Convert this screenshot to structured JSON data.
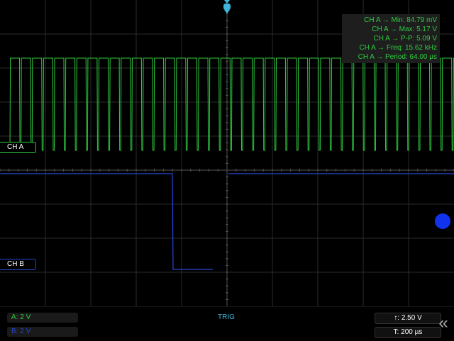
{
  "measurements": [
    "CH A → Min: 84.79 mV",
    "CH A → Max: 5.17 V",
    "CH A → P-P: 5.09 V",
    "CH A → Freq: 15.62 kHz",
    "CH A → Period: 64.00 µs"
  ],
  "channels": {
    "a": {
      "label": "CH A",
      "scale": "A: 2 V",
      "color": "#2ecc40"
    },
    "b": {
      "label": "CH B",
      "scale": "B: 2 V",
      "color": "#2446d6"
    }
  },
  "controls": {
    "trig_label": "TRIG",
    "trig_level": "↑: 2.50 V",
    "timebase": "T: 200 µs"
  },
  "icons": {
    "trigger_position": "trigger-position-icon",
    "collapse": "double-chevron-left-icon",
    "trigger_level_handle": "trigger-level-handle-icon"
  },
  "colors": {
    "grid": "#2a2a2a",
    "trig": "#3fb6d8"
  }
}
